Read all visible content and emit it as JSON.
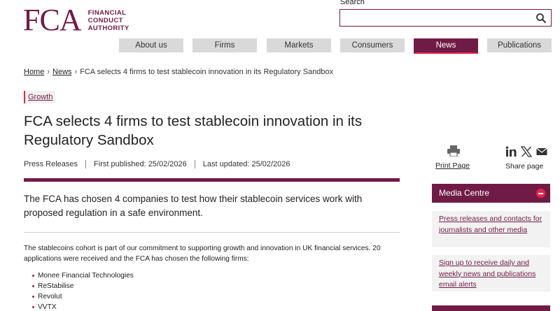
{
  "brand": {
    "mark": "FCA",
    "name_lines": [
      "FINANCIAL",
      "CONDUCT",
      "AUTHORITY"
    ],
    "color": "#701b45",
    "accent": "#e3274a"
  },
  "search": {
    "label": "Search",
    "placeholder": "",
    "icon": "search-icon"
  },
  "nav": {
    "items": [
      {
        "label": "About us"
      },
      {
        "label": "Firms"
      },
      {
        "label": "Markets"
      },
      {
        "label": "Consumers"
      },
      {
        "label": "News",
        "active": true
      },
      {
        "label": "Publications"
      }
    ]
  },
  "breadcrumb": {
    "home": "Home",
    "news": "News",
    "current": "FCA selects 4 firms to test stablecoin innovation in its Regulatory Sandbox"
  },
  "article": {
    "tag": "Growth",
    "title": "FCA selects 4 firms to test stablecoin innovation in its Regulatory Sandbox",
    "type": "Press Releases",
    "first_published": "First published: 25/02/2026",
    "last_updated": "Last updated: 25/02/2026",
    "lead": "The FCA has chosen 4 companies to test how their stablecoin services work with proposed regulation in a safe environment.",
    "body": "The stablecoins cohort is part of our commitment to supporting growth and innovation in UK financial services. 20 applications were received and the FCA has chosen the following firms:",
    "firms": [
      "Monee Financial Technologies",
      "ReStabilise",
      "Revolut",
      "VVTX"
    ]
  },
  "tools": {
    "print_label": "Print Page",
    "share_label": "Share page",
    "share_icons": [
      "linkedin-icon",
      "x-icon",
      "email-icon"
    ]
  },
  "media_centre": {
    "title": "Media Centre",
    "links": [
      "Press releases and contacts for journalists and other media",
      "Sign up to receive daily and weekly news and publications email alerts"
    ]
  }
}
